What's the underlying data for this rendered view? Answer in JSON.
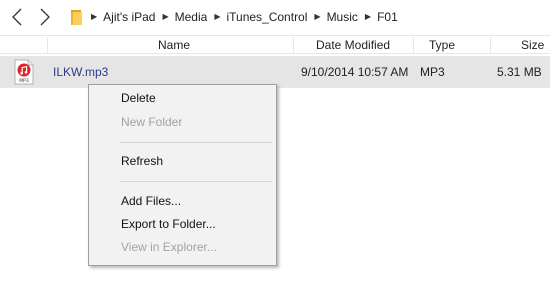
{
  "breadcrumb": [
    "Ajit's iPad",
    "Media",
    "iTunes_Control",
    "Music",
    "F01"
  ],
  "columns": {
    "name": "Name",
    "date_modified": "Date Modified",
    "type": "Type",
    "size": "Size"
  },
  "file": {
    "icon_label": "MP3",
    "name": "ILKW.mp3",
    "date_modified": "9/10/2014 10:57 AM",
    "type": "MP3",
    "size": "5.31 MB"
  },
  "context_menu": [
    {
      "label": "Delete",
      "enabled": true
    },
    {
      "label": "New Folder",
      "enabled": false
    },
    {
      "label": "Refresh",
      "enabled": true
    },
    {
      "label": "Add Files...",
      "enabled": true
    },
    {
      "label": "Export to Folder...",
      "enabled": true
    },
    {
      "label": "View in Explorer...",
      "enabled": false
    }
  ],
  "colors": {
    "selection": "#e5e5e5",
    "menu_bg": "#f2f2f2",
    "file_name": "#2e3a8c",
    "disabled_text": "#a2a2a2",
    "folder_icon": "#f2b32a",
    "mp3_icon": "#d9252b"
  }
}
